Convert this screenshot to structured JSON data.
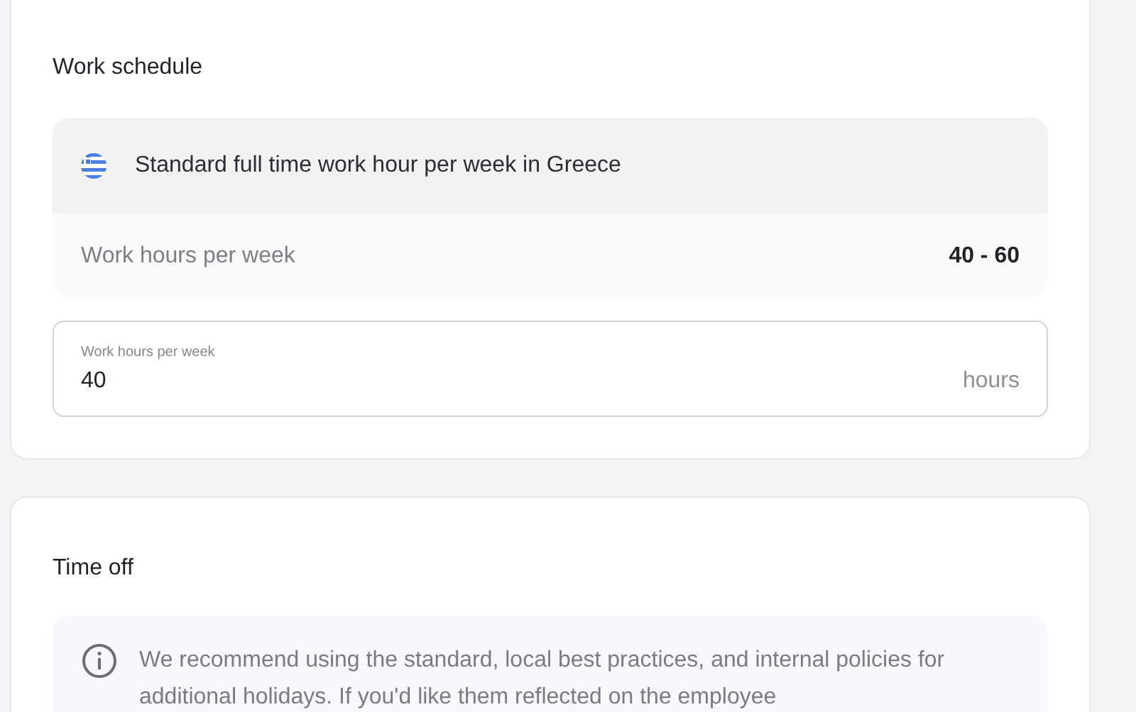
{
  "work_schedule": {
    "title": "Work schedule",
    "standard": {
      "title": "Standard full time work hour per week in Greece",
      "label": "Work hours per week",
      "range": "40 - 60"
    },
    "field": {
      "label": "Work hours per week",
      "value": "40",
      "unit": "hours"
    }
  },
  "time_off": {
    "title": "Time off",
    "notice": "We recommend using the standard, local best practices, and internal policies for additional holidays. If you'd like them reflected on the employee"
  }
}
